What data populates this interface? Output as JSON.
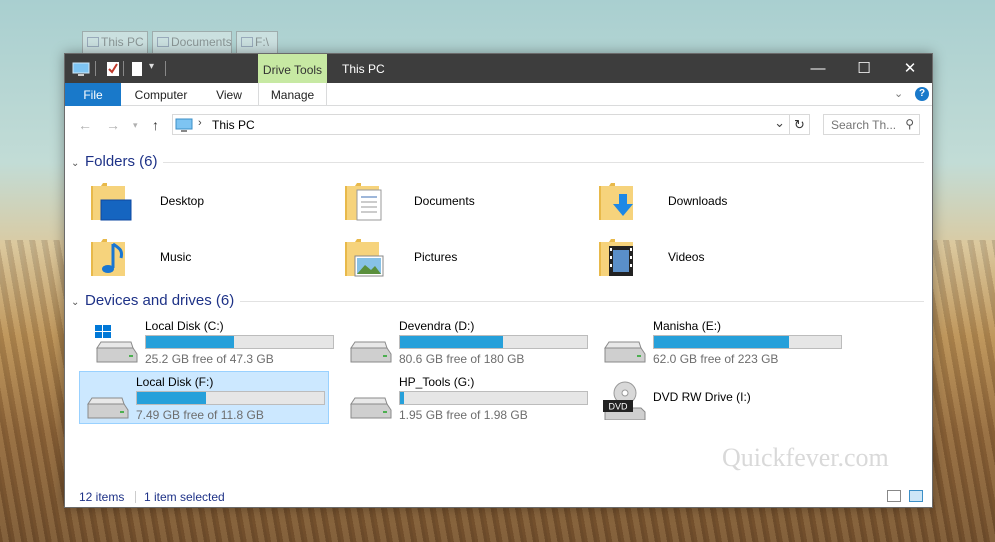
{
  "background_tabs": [
    "This PC",
    "Documents",
    "F:\\"
  ],
  "titlebar": {
    "contextual_tab": "Drive Tools",
    "title": "This PC",
    "minimize": "—",
    "maximize": "☐",
    "close": "✕"
  },
  "ribbon": {
    "tabs": [
      "File",
      "Computer",
      "View",
      "Manage"
    ],
    "collapse_icon": "chevron-down",
    "help": "?"
  },
  "address": {
    "back": "←",
    "forward": "→",
    "up": "↑",
    "path": "This PC",
    "refresh": "↻",
    "search_placeholder": "Search Th...",
    "dropdown": "⌄"
  },
  "folders": {
    "heading": "Folders (6)",
    "items": [
      "Desktop",
      "Documents",
      "Downloads",
      "Music",
      "Pictures",
      "Videos"
    ]
  },
  "drives": {
    "heading": "Devices and drives (6)",
    "items": [
      {
        "name": "Local Disk (C:)",
        "free": "25.2 GB free of 47.3 GB",
        "used_fraction": 0.47
      },
      {
        "name": "Devendra (D:)",
        "free": "80.6 GB free of 180 GB",
        "used_fraction": 0.55
      },
      {
        "name": "Manisha (E:)",
        "free": "62.0 GB free of 223 GB",
        "used_fraction": 0.72
      },
      {
        "name": "Local Disk (F:)",
        "free": "7.49 GB free of 11.8 GB",
        "used_fraction": 0.37
      },
      {
        "name": "HP_Tools (G:)",
        "free": "1.95 GB free of 1.98 GB",
        "used_fraction": 0.02
      },
      {
        "name": "DVD RW Drive (I:)",
        "free": "",
        "used_fraction": 0
      }
    ],
    "dvd_label": "DVD"
  },
  "status": {
    "count": "12 items",
    "selected": "1 item selected"
  },
  "watermark": "Quickfever.com",
  "colors": {
    "accent": "#1979ca",
    "drive_fill": "#26a0da",
    "selection": "#cce8ff",
    "context_tab": "#c7e9a3",
    "group_heading": "#1e3287"
  }
}
